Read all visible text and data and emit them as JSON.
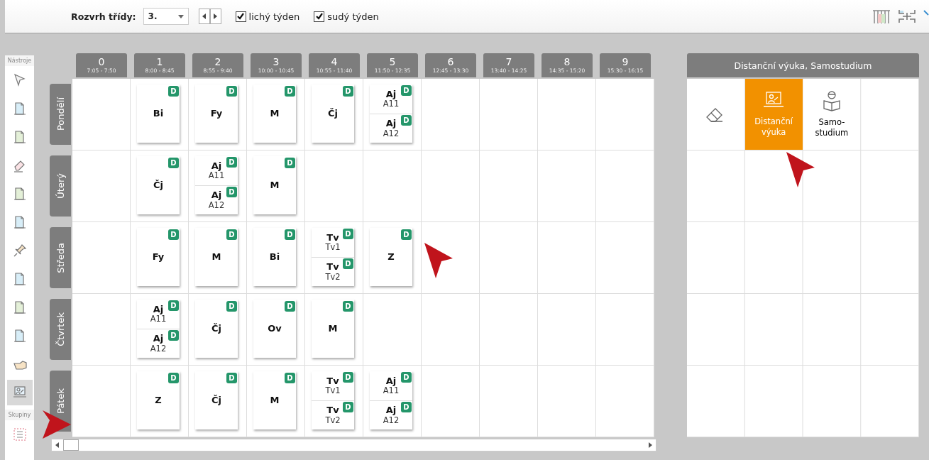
{
  "toolbar": {
    "label": "Rozvrh třídy:",
    "class_select": {
      "value": "3."
    },
    "odd_week": {
      "label": "lichý týden",
      "checked": true
    },
    "even_week": {
      "label": "sudý týden",
      "checked": true
    }
  },
  "tools": {
    "title": "Nástroje",
    "items": [
      {
        "selected": false
      },
      {
        "selected": false
      },
      {
        "selected": false
      },
      {
        "selected": false
      },
      {
        "selected": false
      },
      {
        "selected": false
      },
      {
        "selected": false
      },
      {
        "selected": false
      },
      {
        "selected": false
      },
      {
        "selected": false
      },
      {
        "selected": false
      },
      {
        "selected": true
      }
    ],
    "groups_title": "Skupiny"
  },
  "periods": [
    {
      "number": "0",
      "time": "7:05 - 7:50"
    },
    {
      "number": "1",
      "time": "8:00 - 8:45"
    },
    {
      "number": "2",
      "time": "8:55 - 9:40"
    },
    {
      "number": "3",
      "time": "10:00 - 10:45"
    },
    {
      "number": "4",
      "time": "10:55 - 11:40"
    },
    {
      "number": "5",
      "time": "11:50 - 12:35"
    },
    {
      "number": "6",
      "time": "12:45 - 13:30"
    },
    {
      "number": "7",
      "time": "13:40 - 14:25"
    },
    {
      "number": "8",
      "time": "14:35 - 15:20"
    },
    {
      "number": "9",
      "time": "15:30 - 16:15"
    }
  ],
  "days": [
    {
      "name": "Pondělí",
      "slots": [
        {
          "kind": "free"
        },
        {
          "kind": "lesson",
          "parts": [
            {
              "subject": "Bi",
              "badge": "D"
            }
          ]
        },
        {
          "kind": "lesson",
          "parts": [
            {
              "subject": "Fy",
              "badge": "D"
            }
          ]
        },
        {
          "kind": "lesson",
          "parts": [
            {
              "subject": "M",
              "badge": "D"
            }
          ]
        },
        {
          "kind": "lesson",
          "parts": [
            {
              "subject": "Čj",
              "badge": "D"
            }
          ]
        },
        {
          "kind": "lesson",
          "parts": [
            {
              "subject": "Aj",
              "group": "A11",
              "badge": "D"
            },
            {
              "subject": "Aj",
              "group": "A12",
              "badge": "D"
            }
          ]
        },
        {
          "kind": "free"
        },
        {
          "kind": "free"
        },
        {
          "kind": "free"
        },
        {
          "kind": "free"
        }
      ]
    },
    {
      "name": "Úterý",
      "slots": [
        {
          "kind": "free"
        },
        {
          "kind": "lesson",
          "parts": [
            {
              "subject": "Čj",
              "badge": "D"
            }
          ]
        },
        {
          "kind": "lesson",
          "parts": [
            {
              "subject": "Aj",
              "group": "A11",
              "badge": "D"
            },
            {
              "subject": "Aj",
              "group": "A12",
              "badge": "D"
            }
          ]
        },
        {
          "kind": "lesson",
          "parts": [
            {
              "subject": "M",
              "badge": "D"
            }
          ]
        },
        {
          "kind": "free"
        },
        {
          "kind": "free"
        },
        {
          "kind": "free"
        },
        {
          "kind": "free"
        },
        {
          "kind": "free"
        },
        {
          "kind": "free"
        }
      ]
    },
    {
      "name": "Středa",
      "slots": [
        {
          "kind": "free"
        },
        {
          "kind": "lesson",
          "parts": [
            {
              "subject": "Fy",
              "badge": "D"
            }
          ]
        },
        {
          "kind": "lesson",
          "parts": [
            {
              "subject": "M",
              "badge": "D"
            }
          ]
        },
        {
          "kind": "lesson",
          "parts": [
            {
              "subject": "Bi",
              "badge": "D"
            }
          ]
        },
        {
          "kind": "lesson",
          "parts": [
            {
              "subject": "Tv",
              "group": "Tv1",
              "badge": "D"
            },
            {
              "subject": "Tv",
              "group": "Tv2",
              "badge": "D"
            }
          ]
        },
        {
          "kind": "lesson",
          "parts": [
            {
              "subject": "Z",
              "badge": "D"
            }
          ]
        },
        {
          "kind": "free"
        },
        {
          "kind": "free"
        },
        {
          "kind": "free"
        },
        {
          "kind": "free"
        }
      ]
    },
    {
      "name": "Čtvrtek",
      "slots": [
        {
          "kind": "free"
        },
        {
          "kind": "lesson",
          "parts": [
            {
              "subject": "Aj",
              "group": "A11",
              "badge": "D"
            },
            {
              "subject": "Aj",
              "group": "A12",
              "badge": "D"
            }
          ]
        },
        {
          "kind": "lesson",
          "parts": [
            {
              "subject": "Čj",
              "badge": "D"
            }
          ]
        },
        {
          "kind": "lesson",
          "parts": [
            {
              "subject": "Ov",
              "badge": "D"
            }
          ]
        },
        {
          "kind": "lesson",
          "parts": [
            {
              "subject": "M",
              "badge": "D"
            }
          ]
        },
        {
          "kind": "free"
        },
        {
          "kind": "free"
        },
        {
          "kind": "free"
        },
        {
          "kind": "free"
        },
        {
          "kind": "free"
        }
      ]
    },
    {
      "name": "Pátek",
      "slots": [
        {
          "kind": "free"
        },
        {
          "kind": "lesson",
          "parts": [
            {
              "subject": "Z",
              "badge": "D"
            }
          ]
        },
        {
          "kind": "lesson",
          "parts": [
            {
              "subject": "Čj",
              "badge": "D"
            }
          ]
        },
        {
          "kind": "lesson",
          "parts": [
            {
              "subject": "M",
              "badge": "D"
            }
          ]
        },
        {
          "kind": "lesson",
          "parts": [
            {
              "subject": "Tv",
              "group": "Tv1",
              "badge": "D"
            },
            {
              "subject": "Tv",
              "group": "Tv2",
              "badge": "D"
            }
          ]
        },
        {
          "kind": "lesson",
          "parts": [
            {
              "subject": "Aj",
              "group": "A11",
              "badge": "D"
            },
            {
              "subject": "Aj",
              "group": "A12",
              "badge": "D"
            }
          ]
        },
        {
          "kind": "free"
        },
        {
          "kind": "free"
        },
        {
          "kind": "free"
        },
        {
          "kind": "free"
        }
      ]
    }
  ],
  "palette": {
    "title": "Distanční výuka, Samostudium",
    "items": [
      {
        "kind": "eraser",
        "selected": false
      },
      {
        "kind": "distance",
        "label": "Distanční výuka",
        "selected": true
      },
      {
        "kind": "self_study",
        "label": "Samo-studium",
        "selected": false
      }
    ]
  }
}
